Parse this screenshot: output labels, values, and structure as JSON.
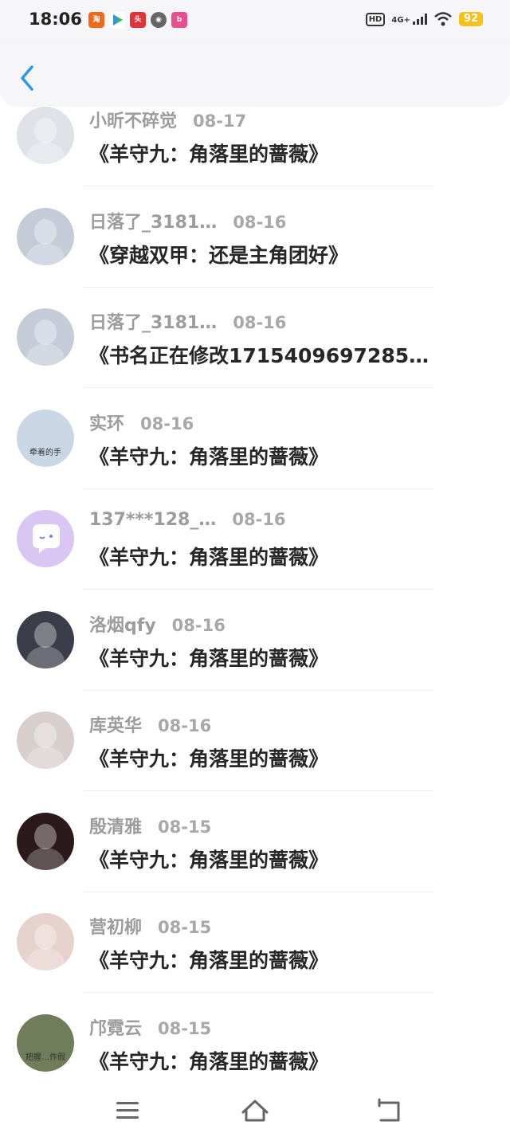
{
  "status_bar": {
    "time": "18:06",
    "apps": [
      "taobao-icon",
      "play-icon",
      "news-icon",
      "sound-icon",
      "bilibili-icon"
    ],
    "hd_label": "HD",
    "network_label": "4G+",
    "battery": "92"
  },
  "header": {
    "back_icon": "chevron-left-icon",
    "accent": "#2a9ae8"
  },
  "items": [
    {
      "user": "小昕不碎觉",
      "date": "08-17",
      "book": "《羊守九：角落里的蔷薇》",
      "avatar_color": "#dfe3e8"
    },
    {
      "user": "日落了_3181…",
      "date": "08-16",
      "book": "《穿越双甲：还是主角团好》",
      "avatar_color": "#c4ccd8"
    },
    {
      "user": "日落了_3181…",
      "date": "08-16",
      "book": "《书名正在修改1715409697285…",
      "avatar_color": "#c4ccd8"
    },
    {
      "user": "实环",
      "date": "08-16",
      "book": "《羊守九：角落里的蔷薇》",
      "avatar_color": "#c9d7e5",
      "avatar_text": "牵着的手"
    },
    {
      "user": "137***128_…",
      "date": "08-16",
      "book": "《羊守九：角落里的蔷薇》",
      "avatar_color": "#d9c6f2"
    },
    {
      "user": "洛烟qfy",
      "date": "08-16",
      "book": "《羊守九：角落里的蔷薇》",
      "avatar_color": "#3b3d48"
    },
    {
      "user": "库英华",
      "date": "08-16",
      "book": "《羊守九：角落里的蔷薇》",
      "avatar_color": "#d8cfcc"
    },
    {
      "user": "殷清雅",
      "date": "08-15",
      "book": "《羊守九：角落里的蔷薇》",
      "avatar_color": "#2a1a1c"
    },
    {
      "user": "营初柳",
      "date": "08-15",
      "book": "《羊守九：角落里的蔷薇》",
      "avatar_color": "#e6d2cc"
    },
    {
      "user": "邝霓云",
      "date": "08-15",
      "book": "《羊守九：角落里的蔷薇》",
      "avatar_color": "#6f7d5a",
      "avatar_text": "把握…作假"
    }
  ],
  "nav": {
    "menu_icon": "menu-icon",
    "home_icon": "home-icon",
    "back_icon": "back-icon"
  }
}
